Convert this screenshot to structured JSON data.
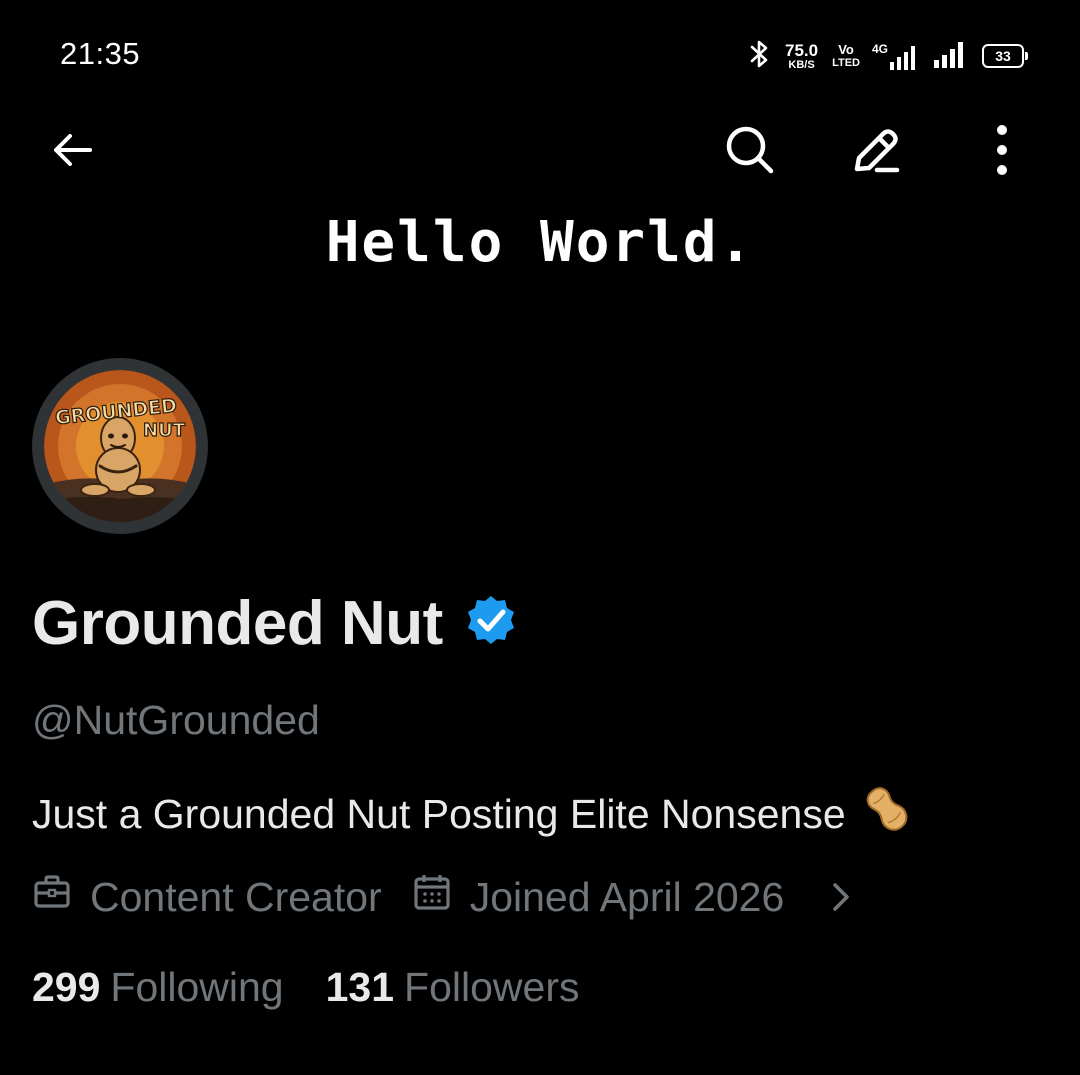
{
  "status_bar": {
    "time": "21:35",
    "net_speed_value": "75.0",
    "net_speed_unit": "KB/S",
    "volte_top": "Vo",
    "volte_bottom": "LTED",
    "network_type": "4G",
    "battery_level": "33",
    "icons": [
      "bluetooth-icon",
      "signal-4g-icon",
      "signal-icon",
      "battery-icon"
    ]
  },
  "nav": {
    "icons": [
      "back-arrow-icon",
      "search-icon",
      "edit-icon",
      "more-vertical-icon"
    ]
  },
  "banner": {
    "text": "Hello World."
  },
  "avatar": {
    "logo_text_line1": "GROUNDED",
    "logo_text_line2": "NUT"
  },
  "profile": {
    "display_name": "Grounded Nut",
    "verified": true,
    "verified_color": "#1d9bf0",
    "handle": "@NutGrounded",
    "bio": "Just a Grounded Nut Posting Elite Nonsense",
    "bio_emoji": "peanut-icon",
    "profession": "Content Creator",
    "joined": "Joined April 2026",
    "following_count": "299",
    "following_label": "Following",
    "followers_count": "131",
    "followers_label": "Followers"
  },
  "colors": {
    "background": "#000000",
    "primary_text": "#e7e9ea",
    "secondary_text": "#71767b",
    "accent": "#1d9bf0"
  }
}
